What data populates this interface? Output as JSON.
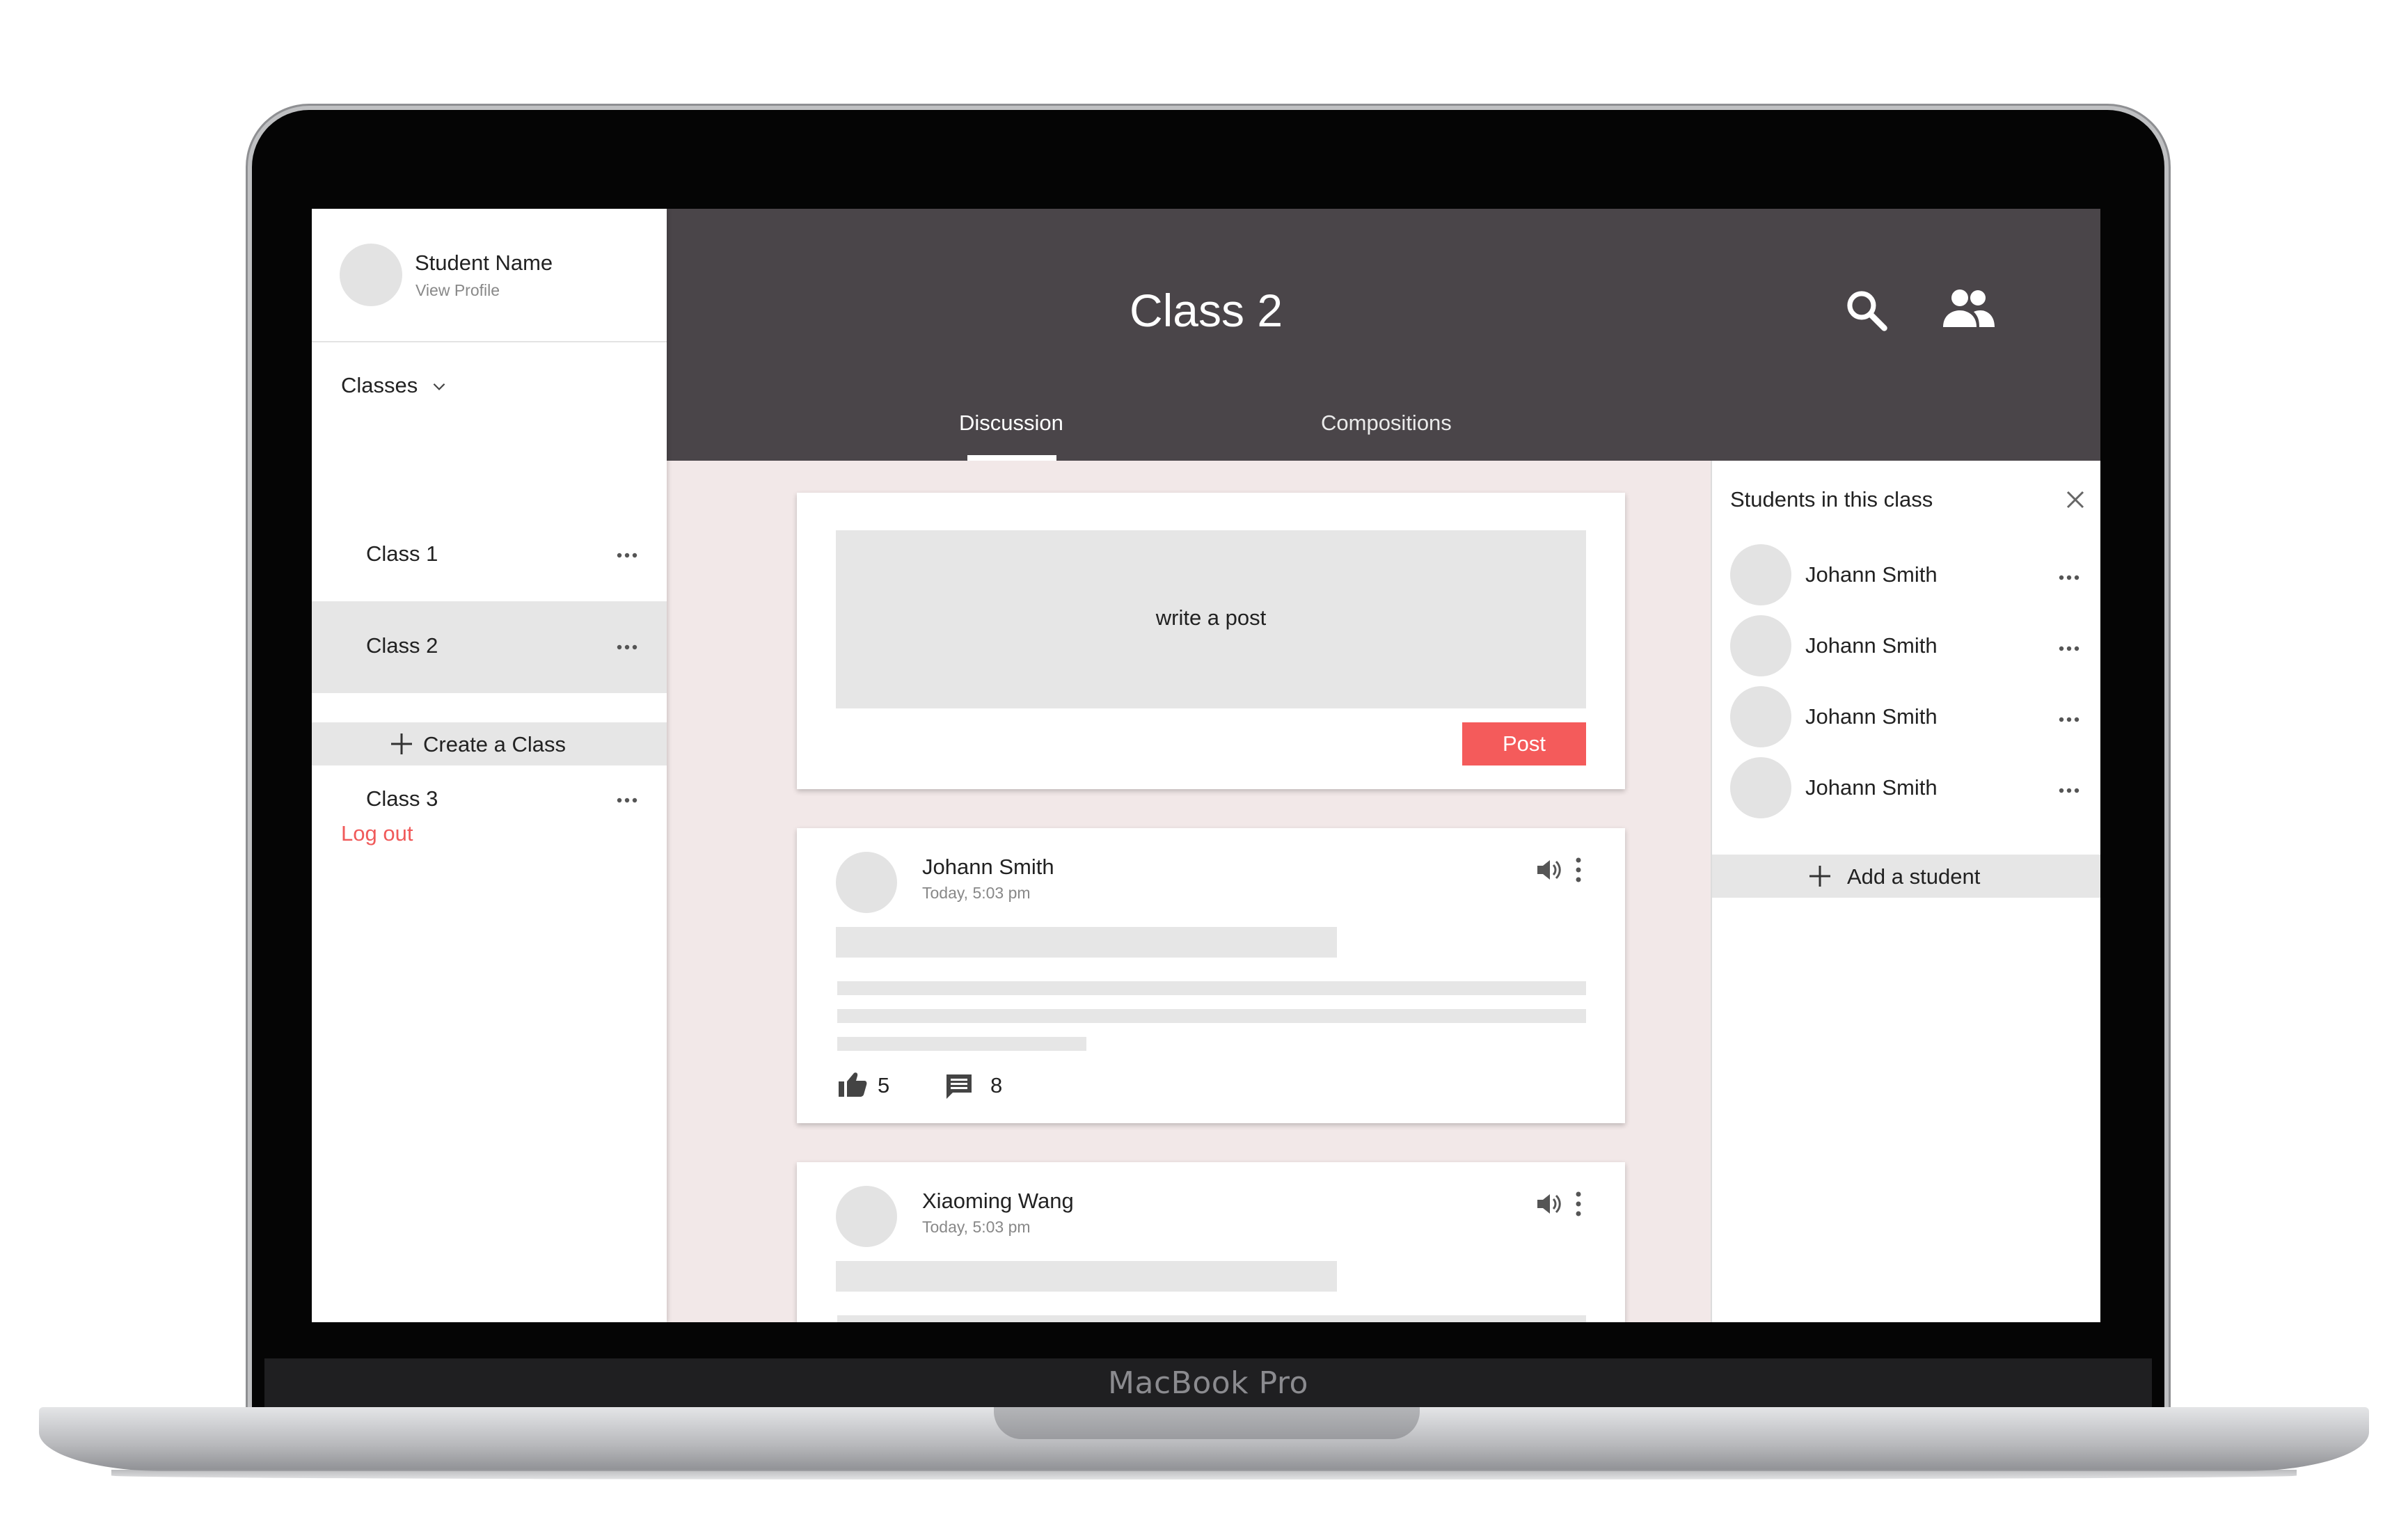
{
  "device": {
    "brand_label": "MacBook Pro"
  },
  "sidebar": {
    "profile": {
      "name": "Student Name",
      "link": "View Profile"
    },
    "classes_label": "Classes",
    "classes": [
      {
        "label": "Class 1",
        "active": false
      },
      {
        "label": "Class 2",
        "active": true
      },
      {
        "label": "Class 3",
        "active": false
      }
    ],
    "create_class_label": "Create a Class",
    "logout_label": "Log out"
  },
  "header": {
    "title": "Class 2",
    "tabs": [
      {
        "label": "Discussion",
        "active": true
      },
      {
        "label": "Compositions",
        "active": false
      }
    ]
  },
  "compose": {
    "placeholder": "write a post",
    "post_label": "Post"
  },
  "posts": [
    {
      "author": "Johann Smith",
      "time": "Today, 5:03 pm",
      "likes": "5",
      "comments": "8"
    },
    {
      "author": "Xiaoming Wang",
      "time": "Today, 5:03 pm"
    }
  ],
  "students_panel": {
    "title": "Students in this class",
    "students": [
      {
        "name": "Johann Smith"
      },
      {
        "name": "Johann Smith"
      },
      {
        "name": "Johann Smith"
      },
      {
        "name": "Johann Smith"
      }
    ],
    "add_label": "Add a student"
  },
  "colors": {
    "header_bg": "#4a4549",
    "accent": "#f45b5b",
    "logout": "#f05a5a",
    "feed_bg": "#f2e8e8",
    "placeholder": "#e6e6e6"
  },
  "icons": {
    "search": "search-icon",
    "people": "people-icon",
    "more": "more-horizontal-icon",
    "kebab": "kebab-vertical-icon",
    "speaker": "speaker-icon",
    "like": "thumbs-up-icon",
    "comment": "comment-icon",
    "close": "close-icon",
    "add": "plus-icon",
    "chevron": "chevron-down-icon"
  }
}
